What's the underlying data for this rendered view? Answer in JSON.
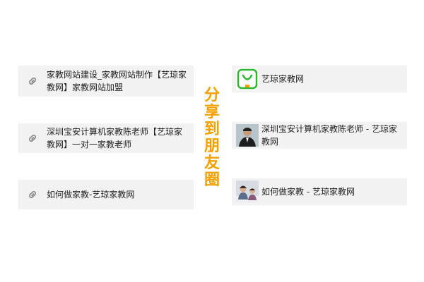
{
  "share_title": "分享到朋友圈",
  "left_cards": [
    {
      "text": "家教网站建设_家教网站制作【艺琼家教网】家教网站加盟",
      "icon": "link-icon"
    },
    {
      "text": "深圳宝安计算机家教陈老师【艺琼家教网】一对一家教老师",
      "icon": "link-icon"
    },
    {
      "text": "如何做家教-艺琼家教网",
      "icon": "link-icon"
    }
  ],
  "right_cards": [
    {
      "text": "艺琼家教网",
      "thumb": "site-logo"
    },
    {
      "text": "深圳宝安计算机家教陈老师 - 艺琼家教网",
      "thumb": "teacher-photo"
    },
    {
      "text": "如何做家教 - 艺琼家教网",
      "thumb": "study-photo"
    }
  ],
  "colors": {
    "accent": "#f5a000",
    "card_bg": "#f2f2f2",
    "logo_green": "#2eb82e",
    "logo_orange": "#f5a000"
  }
}
